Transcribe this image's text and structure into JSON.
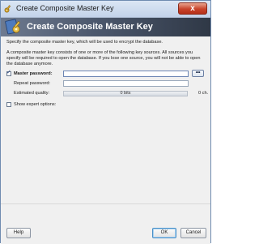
{
  "window": {
    "title": "Create Composite Master Key",
    "close_symbol": "x"
  },
  "banner": {
    "title": "Create Composite Master Key"
  },
  "description": "Specify the composite master key, which will be used to encrypt the database.",
  "info": "A composite master key consists of one or more of the following key sources. All sources you specify will be required to open the database. If you lose one source, you will not be able to open the database anymore.",
  "master_password": {
    "checkbox_label": "Master password:",
    "checked": true,
    "value": "",
    "hide_button_label": "•••"
  },
  "repeat_password": {
    "label": "Repeat password:",
    "value": ""
  },
  "quality": {
    "label": "Estimated quality:",
    "bits_text": "0 bits",
    "chars_text": "0 ch.",
    "level": 0
  },
  "expert": {
    "label": "Show expert options:",
    "checked": false
  },
  "buttons": {
    "help": "Help",
    "ok": "OK",
    "cancel": "Cancel"
  },
  "colors": {
    "banner_dark": "#2f3846",
    "close_red": "#c8432b",
    "quality_green": "#5fb04a"
  },
  "icons": {
    "title": "key-icon",
    "banner": "key-icon"
  }
}
